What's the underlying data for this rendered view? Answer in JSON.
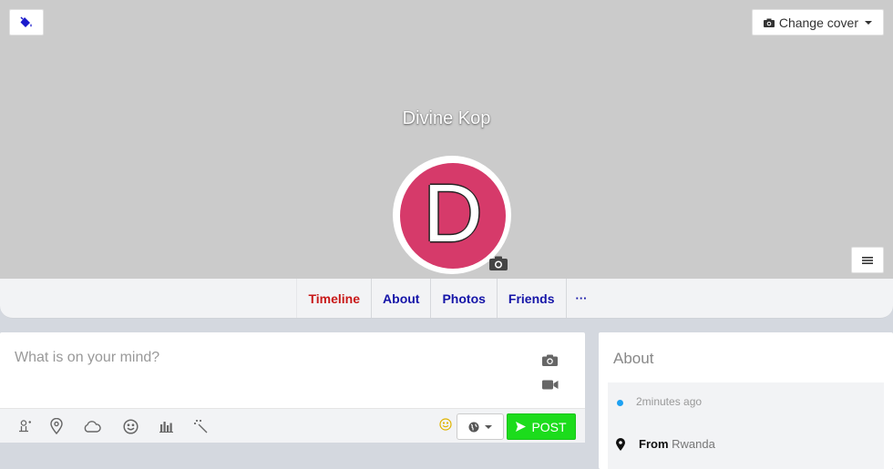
{
  "cover": {
    "change_cover_label": "Change cover",
    "background": "#cbcbcb"
  },
  "profile": {
    "name": "Divine Kop",
    "avatar_letter": "D",
    "avatar_color": "#d63a6a"
  },
  "nav": {
    "tabs": [
      {
        "label": "Timeline",
        "active": true
      },
      {
        "label": "About",
        "active": false
      },
      {
        "label": "Photos",
        "active": false
      },
      {
        "label": "Friends",
        "active": false
      },
      {
        "label": "···",
        "active": false
      }
    ],
    "active_color": "#c81818",
    "link_color": "#1515a8"
  },
  "composer": {
    "placeholder": "What is on your mind?",
    "post_label": "POST",
    "post_color": "#1cdc1c",
    "tools": [
      "user-tag-icon",
      "location-pin-icon",
      "cloud-icon",
      "smiley-icon",
      "bar-chart-icon",
      "magic-wand-icon"
    ],
    "side_icons": [
      "camera-icon",
      "video-icon"
    ]
  },
  "about": {
    "title": "About",
    "time": "2minutes ago",
    "from_label": "From",
    "from_value": "Rwanda"
  }
}
